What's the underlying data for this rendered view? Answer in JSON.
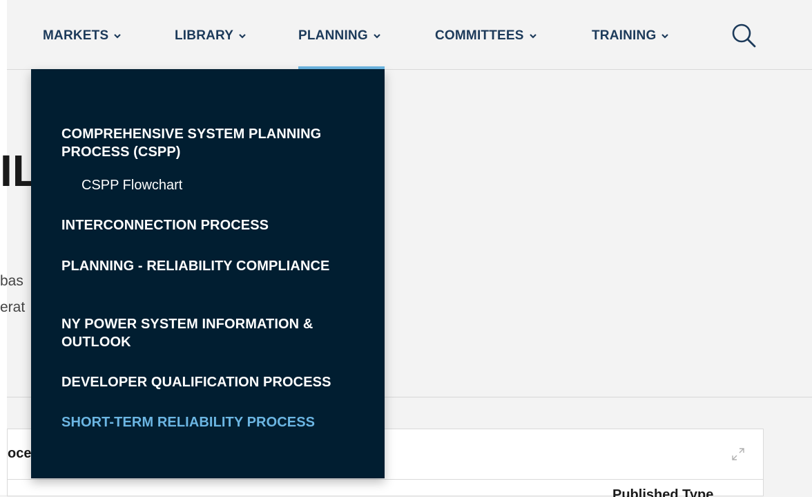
{
  "nav": {
    "items": [
      {
        "label": "MARKETS"
      },
      {
        "label": "LIBRARY"
      },
      {
        "label": "PLANNING"
      },
      {
        "label": "COMMITTEES"
      },
      {
        "label": "TRAINING"
      }
    ],
    "active_index": 2,
    "search_icon": "search-icon",
    "chevron_icon": "chevron-down-icon"
  },
  "dropdown": {
    "sections": [
      {
        "label": "COMPREHENSIVE SYSTEM PLANNING PROCESS (CSPP)",
        "children": [
          {
            "label": "CSPP Flowchart"
          }
        ]
      },
      {
        "label": "INTERCONNECTION PROCESS"
      },
      {
        "label": "PLANNING - RELIABILITY COMPLIANCE"
      },
      {
        "label": "NY POWER SYSTEM INFORMATION & OUTLOOK"
      },
      {
        "label": "DEVELOPER QUALIFICATION PROCESS"
      },
      {
        "label": "SHORT-TERM RELIABILITY PROCESS"
      }
    ],
    "active_index": 5
  },
  "background": {
    "heading_fragment": "IL",
    "text_fragment_1": "bas",
    "text_fragment_2": "erat",
    "card_title_fragment": "oce",
    "card_column_fragment": "Published    Type",
    "expand_icon": "expand-icon"
  },
  "colors": {
    "nav_text": "#1c3a5a",
    "accent": "#6cb6e3",
    "dropdown_bg": "#011e31",
    "page_bg": "#f3f3f3"
  }
}
